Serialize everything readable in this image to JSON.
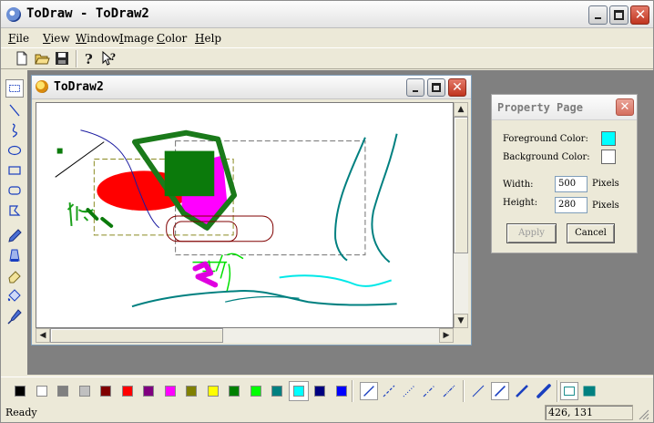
{
  "app": {
    "title": "ToDraw - ToDraw2"
  },
  "menu": [
    {
      "pre": "",
      "ul": "F",
      "post": "ile"
    },
    {
      "pre": "",
      "ul": "V",
      "post": "iew"
    },
    {
      "pre": "",
      "ul": "W",
      "post": "indow"
    },
    {
      "pre": "",
      "ul": "I",
      "post": "mage"
    },
    {
      "pre": "",
      "ul": "C",
      "post": "olor"
    },
    {
      "pre": "",
      "ul": "H",
      "post": "elp"
    }
  ],
  "toolbar": {
    "icons": [
      "new-file-icon",
      "open-folder-icon",
      "save-icon",
      "help-icon",
      "context-help-icon"
    ]
  },
  "tools": [
    "select-rectangle-icon",
    "line-icon",
    "curve-icon",
    "ellipse-icon",
    "rectangle-icon",
    "rounded-rectangle-icon",
    "polygon-icon",
    "pencil-icon",
    "fill-icon",
    "eraser-icon",
    "paint-bucket-icon",
    "eyedropper-icon"
  ],
  "document": {
    "title": "ToDraw2"
  },
  "property_page": {
    "title": "Property Page",
    "foreground_label": "Foreground Color:",
    "foreground_color": "#00ffff",
    "background_label": "Background Color:",
    "background_color": "#ffffff",
    "width_label": "Width:",
    "width_value": "500",
    "width_unit": "Pixels",
    "height_label": "Height:",
    "height_value": "280",
    "height_unit": "Pixels",
    "apply_label": "Apply",
    "cancel_label": "Cancel"
  },
  "palette": {
    "colors": [
      "#000000",
      "#ffffff",
      "#808080",
      "#c0c0c0",
      "#800000",
      "#ff0000",
      "#800080",
      "#ff00ff",
      "#808000",
      "#ffff00",
      "#008000",
      "#00ff00",
      "#008080",
      "#00ffff",
      "#000080",
      "#0000ff"
    ],
    "selected_index": 13
  },
  "line_styles": [
    "solid-thin-line-icon",
    "dash-line-icon",
    "dot-line-icon",
    "dash-dot-line-icon",
    "dash-dot-dot-line-icon",
    "width-1-line-icon",
    "width-2-line-icon",
    "width-3-line-icon",
    "width-4-line-icon",
    "no-fill-icon",
    "solid-fill-icon"
  ],
  "status": {
    "text": "Ready",
    "coords": "426, 131"
  }
}
